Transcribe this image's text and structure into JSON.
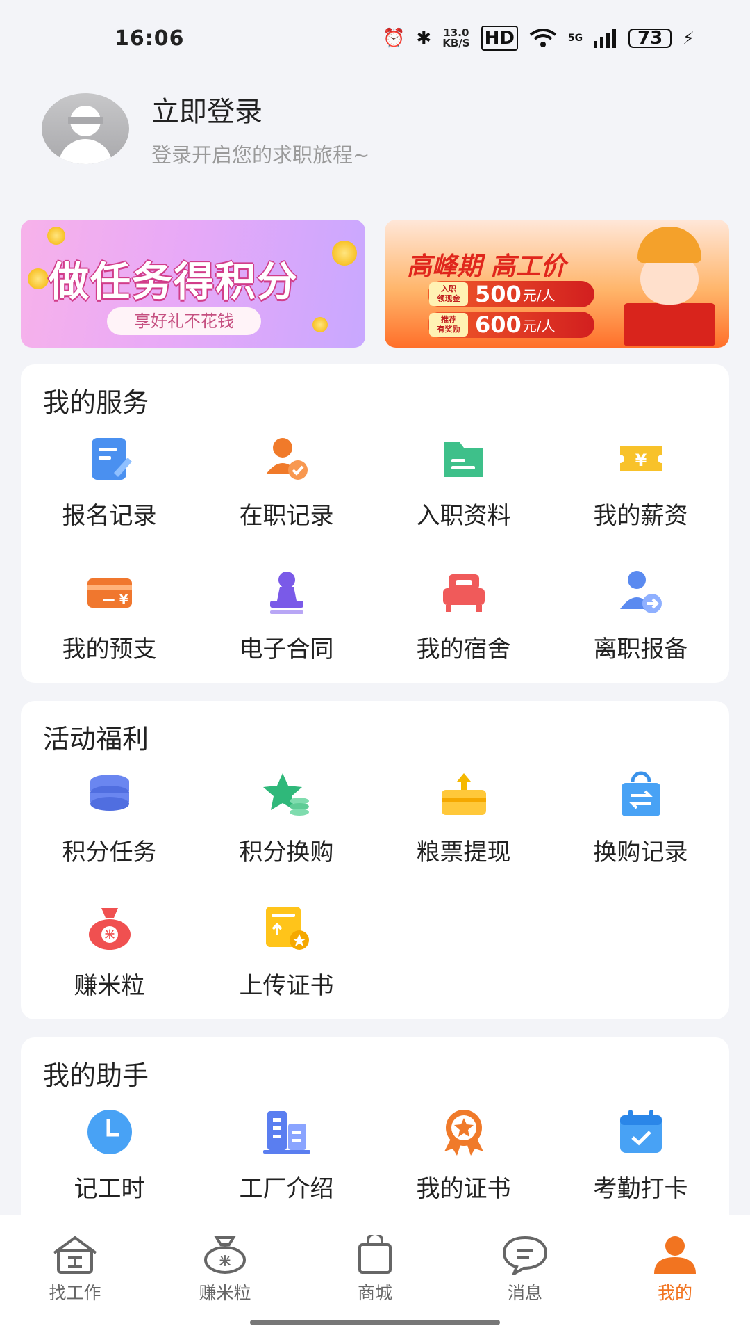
{
  "status_bar": {
    "time": "16:06",
    "net_speed_value": "13.0",
    "net_speed_unit": "KB/S",
    "hd": "HD",
    "network": "5G",
    "battery": "73"
  },
  "profile": {
    "title": "立即登录",
    "subtitle": "登录开启您的求职旅程~"
  },
  "banners": {
    "left": {
      "title": "做任务得积分",
      "subtitle": "享好礼不花钱"
    },
    "right": {
      "title": "高峰期 高工价",
      "rows": [
        {
          "tag_top": "入职",
          "tag_bottom": "领现金",
          "amount": "500",
          "unit": "元/人"
        },
        {
          "tag_top": "推荐",
          "tag_bottom": "有奖励",
          "amount": "600",
          "unit": "元/人"
        }
      ]
    }
  },
  "services": {
    "title": "我的服务",
    "items": [
      {
        "label": "报名记录",
        "icon": "signup-record-icon"
      },
      {
        "label": "在职记录",
        "icon": "employment-record-icon"
      },
      {
        "label": "入职资料",
        "icon": "onboarding-folder-icon"
      },
      {
        "label": "我的薪资",
        "icon": "salary-ticket-icon"
      },
      {
        "label": "我的预支",
        "icon": "advance-card-icon"
      },
      {
        "label": "电子合同",
        "icon": "e-contract-stamp-icon"
      },
      {
        "label": "我的宿舍",
        "icon": "dorm-bed-icon"
      },
      {
        "label": "离职报备",
        "icon": "resignation-icon"
      }
    ]
  },
  "welfare": {
    "title": "活动福利",
    "items": [
      {
        "label": "积分任务",
        "icon": "points-stack-icon"
      },
      {
        "label": "积分换购",
        "icon": "star-coins-icon"
      },
      {
        "label": "粮票提现",
        "icon": "withdraw-box-icon"
      },
      {
        "label": "换购记录",
        "icon": "exchange-bag-icon"
      },
      {
        "label": "赚米粒",
        "icon": "rice-bag-icon"
      },
      {
        "label": "上传证书",
        "icon": "certificate-upload-icon"
      }
    ]
  },
  "assistant": {
    "title": "我的助手",
    "items": [
      {
        "label": "记工时",
        "icon": "clock-icon"
      },
      {
        "label": "工厂介绍",
        "icon": "factory-building-icon"
      },
      {
        "label": "我的证书",
        "icon": "award-badge-icon"
      },
      {
        "label": "考勤打卡",
        "icon": "calendar-check-icon"
      }
    ]
  },
  "tabbar": {
    "items": [
      {
        "label": "找工作",
        "icon": "find-job-icon",
        "active": false
      },
      {
        "label": "赚米粒",
        "icon": "rice-bag-tab-icon",
        "active": false
      },
      {
        "label": "商城",
        "icon": "shopping-bag-icon",
        "active": false
      },
      {
        "label": "消息",
        "icon": "message-bubble-icon",
        "active": false
      },
      {
        "label": "我的",
        "icon": "user-profile-icon",
        "active": true
      }
    ]
  },
  "colors": {
    "background": "#F3F4F8",
    "accent": "#F27420",
    "card": "#FFFFFF"
  }
}
